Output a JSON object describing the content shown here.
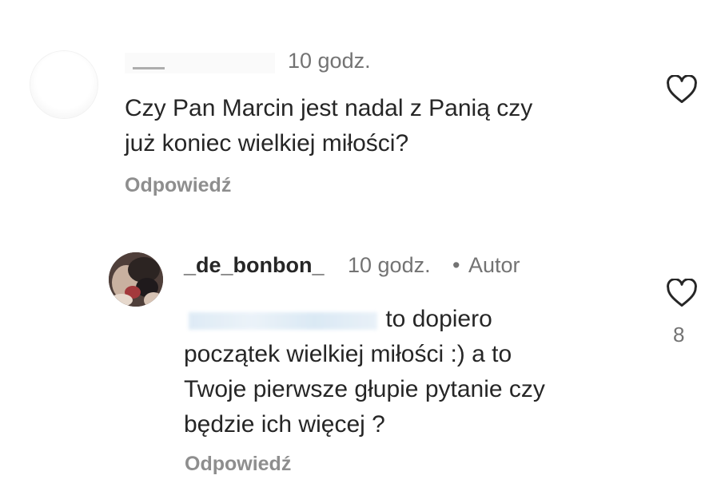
{
  "comments": [
    {
      "time": "10 godz.",
      "text_line1": "Czy Pan Marcin jest nadal z Panią czy",
      "text_line2": "już koniec wielkiej miłości?",
      "reply_label": "Odpowiedź",
      "icon": "heart-outline-icon"
    },
    {
      "username": "_de_bonbon_",
      "time": "10 godz.",
      "separator": "•",
      "badge": "Autor",
      "text_line1": "to dopiero",
      "text_line2": "początek wielkiej miłości :) a to",
      "text_line3": "Twoje pierwsze głupie pytanie czy",
      "text_line4": "będzie ich więcej ?",
      "reply_label": "Odpowiedź",
      "like_count": "8",
      "icon": "heart-outline-icon"
    }
  ],
  "colors": {
    "text_primary": "#262626",
    "text_secondary": "#737373",
    "reply_gray": "#8e8e8e"
  }
}
